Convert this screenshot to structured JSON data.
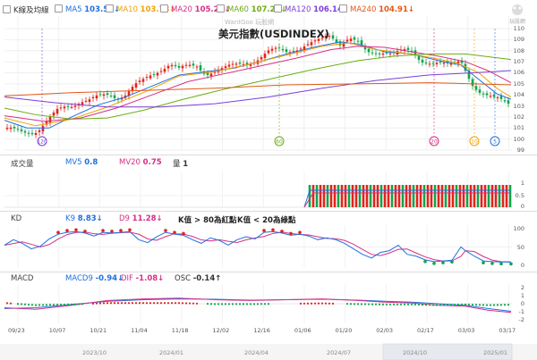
{
  "header": {
    "k_label": "K線及均線",
    "ma": [
      {
        "name": "MA5",
        "value": "103.56↓",
        "color": "#1f6fe0",
        "checked": true
      },
      {
        "name": "MA10",
        "value": "103.73↓",
        "color": "#f0a202",
        "checked": true
      },
      {
        "name": "MA20",
        "value": "105.20↓",
        "color": "#d62f86",
        "checked": true
      },
      {
        "name": "MA60",
        "value": "107.26↓",
        "color": "#6aac14",
        "checked": true
      },
      {
        "name": "MA120",
        "value": "106.14↑",
        "color": "#7b3fd6",
        "checked": true
      },
      {
        "name": "MA240",
        "value": "104.91↓",
        "color": "#e05a16",
        "checked": true
      }
    ]
  },
  "watermark": "WantGoo 玩股網",
  "logo_text": "玩股網",
  "main_chart": {
    "title": "美元指數(USDINDEX)",
    "y_ticks": [
      "110",
      "109",
      "108",
      "107",
      "106",
      "105",
      "104",
      "103",
      "102",
      "101",
      "100",
      "99"
    ],
    "markers": [
      {
        "label": "120",
        "color": "#7b3fd6"
      },
      {
        "label": "60",
        "color": "#6aac14"
      },
      {
        "label": "20",
        "color": "#d62f86"
      },
      {
        "label": "10",
        "color": "#f0a202"
      },
      {
        "label": "5",
        "color": "#1f6fe0"
      }
    ]
  },
  "volume": {
    "label": "成交量",
    "mv5_label": "MV5",
    "mv5_value": "0.8",
    "mv20_label": "MV20",
    "mv20_value": "0.75",
    "qty_label": "量",
    "qty_value": "1",
    "y_ticks": [
      "1",
      "0.5",
      "0"
    ]
  },
  "kd": {
    "label": "KD",
    "k_label": "K9",
    "k_value": "8.83↓",
    "d_label": "D9",
    "d_value": "11.28↓",
    "note1": "K值 > 80為紅點",
    "note2": "K值 < 20為綠點",
    "y_ticks": [
      "100",
      "50",
      "0"
    ]
  },
  "macd": {
    "label": "MACD",
    "macd9_label": "MACD9",
    "macd9_value": "-0.94↓",
    "dif_label": "DIF",
    "dif_value": "-1.08↓",
    "osc_label": "OSC",
    "osc_value": "-0.14↑",
    "y_ticks": [
      "2",
      "1",
      "0",
      "-1",
      "-2"
    ]
  },
  "x_labels": [
    "09/23",
    "10/07",
    "10/21",
    "11/04",
    "11/18",
    "12/02",
    "12/16",
    "01/06",
    "01/20",
    "02/03",
    "02/17",
    "03/03",
    "03/17"
  ],
  "bottom_labels": [
    "2023/10",
    "2024/01",
    "2024/04",
    "2024/07",
    "2024/10",
    "2025/01"
  ]
}
